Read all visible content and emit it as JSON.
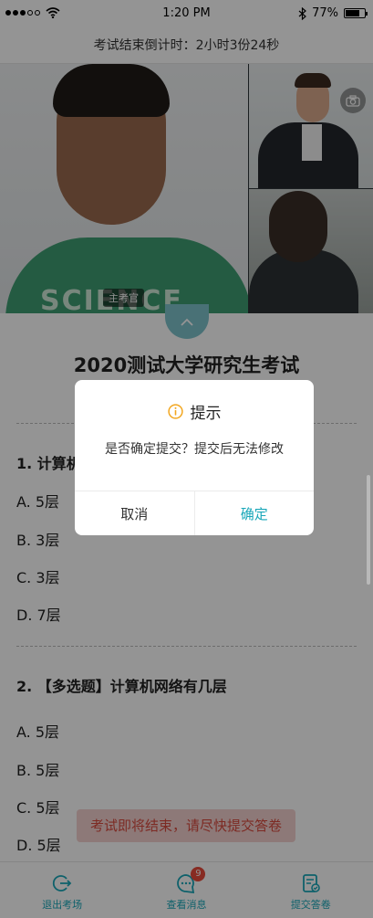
{
  "status_bar": {
    "time": "1:20 PM",
    "battery_percent": "77%",
    "battery_level": 0.77
  },
  "countdown": {
    "label": "考试结束倒计时：",
    "value": "2小时3份24秒"
  },
  "video": {
    "examiner_tag": "主考官",
    "shirt_text": "SCIENCE"
  },
  "exam": {
    "title": "2020测试大学研究生考试",
    "questions": [
      {
        "text": "1. 计算机",
        "options": [
          "A. 5层",
          "B. 3层",
          "C. 3层",
          "D. 7层"
        ]
      },
      {
        "text": "2. 【多选题】计算机网络有几层",
        "options": [
          "A. 5层",
          "B. 5层",
          "C. 5层",
          "D. 5层"
        ]
      }
    ]
  },
  "toast": {
    "text": "考试即将结束，请尽快提交答卷"
  },
  "tab_bar": {
    "items": [
      {
        "label": "退出考场",
        "icon": "exit-icon"
      },
      {
        "label": "查看消息",
        "icon": "message-icon",
        "badge": "9"
      },
      {
        "label": "提交答卷",
        "icon": "submit-doc-icon"
      }
    ]
  },
  "dialog": {
    "title": "提示",
    "message": "是否确定提交？提交后无法修改",
    "cancel_label": "取消",
    "confirm_label": "确定",
    "icon": "info-icon"
  },
  "colors": {
    "accent": "#19a7b9",
    "toast_text": "#d74a3f",
    "badge": "#e84b3c"
  }
}
